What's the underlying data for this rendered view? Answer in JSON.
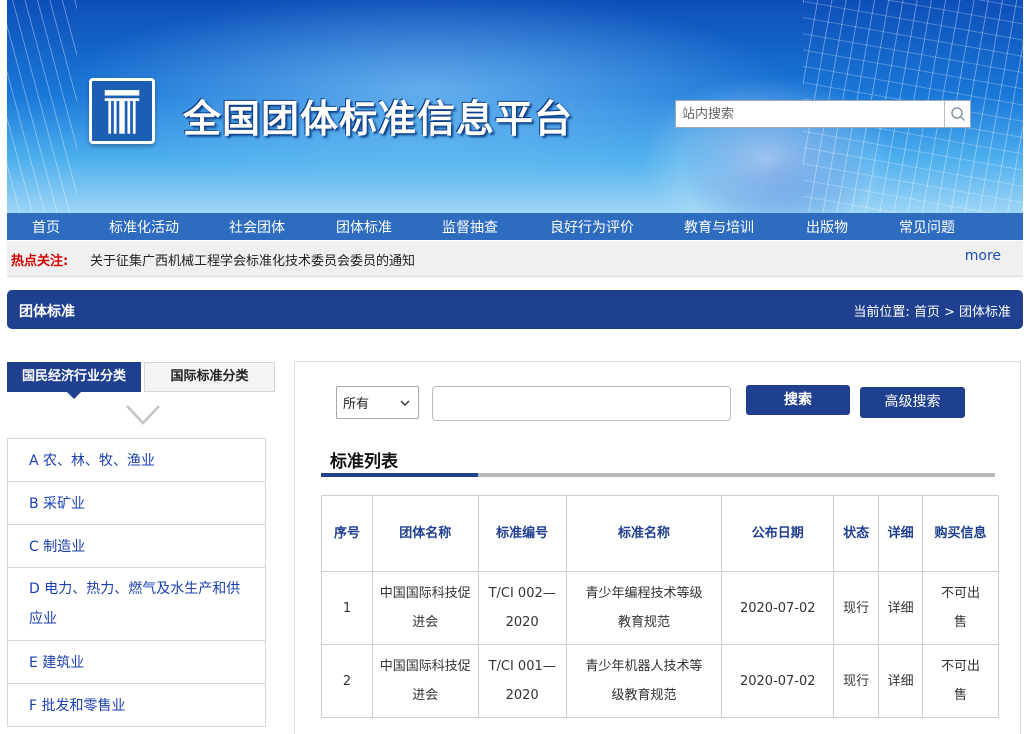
{
  "header": {
    "site_title": "全国团体标准信息平台",
    "search_placeholder": "站内搜索"
  },
  "nav": {
    "items": [
      "首页",
      "标准化活动",
      "社会团体",
      "团体标准",
      "监督抽查",
      "良好行为评价",
      "教育与培训",
      "出版物",
      "常见问题"
    ]
  },
  "hot": {
    "label": "热点关注:",
    "text": "关于征集广西机械工程学会标准化技术委员会委员的通知",
    "more": "more"
  },
  "section": {
    "title": "团体标准",
    "breadcrumb": "当前位置: 首页 > 团体标准"
  },
  "sidebar": {
    "tab_active": "国民经济行业分类",
    "tab_inactive": "国际标准分类",
    "categories": [
      "A 农、林、牧、渔业",
      "B 采矿业",
      "C 制造业",
      "D 电力、热力、燃气及水生产和供应业",
      "E 建筑业",
      "F 批发和零售业"
    ]
  },
  "search": {
    "filter_selected": "所有",
    "query_value": "",
    "search_button": "搜索",
    "advanced_button": "高级搜索"
  },
  "list": {
    "title": "标准列表",
    "columns": [
      "序号",
      "团体名称",
      "标准编号",
      "标准名称",
      "公布日期",
      "状态",
      "详细",
      "购买信息"
    ],
    "rows": [
      [
        "1",
        "中国国际科技促进会",
        "T/CI 002—2020",
        "青少年编程技术等级教育规范",
        "2020-07-02",
        "现行",
        "详细",
        "不可出售"
      ],
      [
        "2",
        "中国国际科技促进会",
        "T/CI 001—2020",
        "青少年机器人技术等级教育规范",
        "2020-07-02",
        "现行",
        "详细",
        "不可出售"
      ]
    ]
  },
  "colors": {
    "primary_navy": "#1f3f8f",
    "nav_blue": "#2e6cc0",
    "hot_red": "#d40000",
    "link_blue": "#1a3fb0",
    "detail_purple": "#8a2b9a"
  }
}
